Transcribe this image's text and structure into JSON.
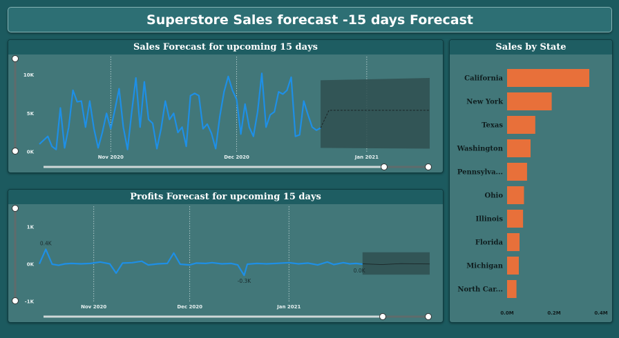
{
  "dashboard": {
    "title": "Superstore Sales forecast -15 days Forecast"
  },
  "panels": {
    "sales": {
      "title": "Sales Forecast for upcoming 15 days"
    },
    "profit": {
      "title": "Profits Forecast for upcoming 15 days"
    },
    "state": {
      "title": "Sales by State"
    }
  },
  "colors": {
    "background": "#1c5a5f",
    "panel": "#427779",
    "line": "#1e8fe6",
    "bar": "#e8703a",
    "forecast_band": "#2f4f50"
  },
  "chart_data": [
    {
      "type": "line",
      "title": "Sales Forecast for upcoming 15 days",
      "xlabel": "",
      "ylabel": "",
      "x_ticks": [
        "Nov 2020",
        "Dec 2020",
        "Jan 2021"
      ],
      "y_ticks": [
        "0K",
        "5K",
        "10K"
      ],
      "ylim": [
        0,
        10500
      ],
      "x_range": [
        "2020-10-15",
        "2021-01-16"
      ],
      "grid": false,
      "series": [
        {
          "values": [
            {
              "x": "2020-10-15",
              "y": 1000
            },
            {
              "x": "2020-10-16",
              "y": 1500
            },
            {
              "x": "2020-10-17",
              "y": 2000
            },
            {
              "x": "2020-10-18",
              "y": 700
            },
            {
              "x": "2020-10-19",
              "y": 300
            },
            {
              "x": "2020-10-20",
              "y": 5700
            },
            {
              "x": "2020-10-21",
              "y": 500
            },
            {
              "x": "2020-10-22",
              "y": 3200
            },
            {
              "x": "2020-10-23",
              "y": 8000
            },
            {
              "x": "2020-10-24",
              "y": 6500
            },
            {
              "x": "2020-10-25",
              "y": 6600
            },
            {
              "x": "2020-10-26",
              "y": 3200
            },
            {
              "x": "2020-10-27",
              "y": 6600
            },
            {
              "x": "2020-10-28",
              "y": 3000
            },
            {
              "x": "2020-10-29",
              "y": 500
            },
            {
              "x": "2020-10-30",
              "y": 2500
            },
            {
              "x": "2020-10-31",
              "y": 5000
            },
            {
              "x": "2020-11-01",
              "y": 3000
            },
            {
              "x": "2020-11-02",
              "y": 5500
            },
            {
              "x": "2020-11-03",
              "y": 8200
            },
            {
              "x": "2020-11-04",
              "y": 3200
            },
            {
              "x": "2020-11-05",
              "y": 300
            },
            {
              "x": "2020-11-06",
              "y": 5200
            },
            {
              "x": "2020-11-07",
              "y": 9600
            },
            {
              "x": "2020-11-08",
              "y": 3200
            },
            {
              "x": "2020-11-09",
              "y": 9100
            },
            {
              "x": "2020-11-10",
              "y": 4200
            },
            {
              "x": "2020-11-11",
              "y": 3700
            },
            {
              "x": "2020-11-12",
              "y": 400
            },
            {
              "x": "2020-11-13",
              "y": 3000
            },
            {
              "x": "2020-11-14",
              "y": 6600
            },
            {
              "x": "2020-11-15",
              "y": 4200
            },
            {
              "x": "2020-11-16",
              "y": 5000
            },
            {
              "x": "2020-11-17",
              "y": 2500
            },
            {
              "x": "2020-11-18",
              "y": 3200
            },
            {
              "x": "2020-11-19",
              "y": 700
            },
            {
              "x": "2020-11-20",
              "y": 7300
            },
            {
              "x": "2020-11-21",
              "y": 7600
            },
            {
              "x": "2020-11-22",
              "y": 7300
            },
            {
              "x": "2020-11-23",
              "y": 3000
            },
            {
              "x": "2020-11-24",
              "y": 3600
            },
            {
              "x": "2020-11-25",
              "y": 2400
            },
            {
              "x": "2020-11-26",
              "y": 400
            },
            {
              "x": "2020-11-27",
              "y": 4600
            },
            {
              "x": "2020-11-28",
              "y": 7800
            },
            {
              "x": "2020-11-29",
              "y": 9800
            },
            {
              "x": "2020-11-30",
              "y": 8000
            },
            {
              "x": "2020-12-01",
              "y": 6800
            },
            {
              "x": "2020-12-02",
              "y": 2300
            },
            {
              "x": "2020-12-03",
              "y": 6200
            },
            {
              "x": "2020-12-04",
              "y": 3200
            },
            {
              "x": "2020-12-05",
              "y": 2000
            },
            {
              "x": "2020-12-06",
              "y": 5200
            },
            {
              "x": "2020-12-07",
              "y": 10200
            },
            {
              "x": "2020-12-08",
              "y": 3200
            },
            {
              "x": "2020-12-09",
              "y": 4800
            },
            {
              "x": "2020-12-10",
              "y": 5200
            },
            {
              "x": "2020-12-11",
              "y": 7800
            },
            {
              "x": "2020-12-12",
              "y": 7500
            },
            {
              "x": "2020-12-13",
              "y": 8000
            },
            {
              "x": "2020-12-14",
              "y": 9700
            },
            {
              "x": "2020-12-15",
              "y": 2000
            },
            {
              "x": "2020-12-16",
              "y": 2200
            },
            {
              "x": "2020-12-17",
              "y": 6600
            },
            {
              "x": "2020-12-18",
              "y": 4800
            },
            {
              "x": "2020-12-19",
              "y": 3200
            },
            {
              "x": "2020-12-20",
              "y": 2800
            },
            {
              "x": "2020-12-21",
              "y": 3100
            }
          ]
        }
      ],
      "forecast": {
        "x": [
          "2020-12-21",
          "2021-01-16"
        ],
        "point": 5400,
        "lower_start": 500,
        "lower_end": 400,
        "upper_start": 9300,
        "upper_end": 9600
      }
    },
    {
      "type": "line",
      "title": "Profits Forecast for upcoming 15 days",
      "xlabel": "",
      "ylabel": "",
      "x_ticks": [
        "Nov 2020",
        "Dec 2020",
        "Jan 2021"
      ],
      "y_ticks": [
        "-1K",
        "0K",
        "1K"
      ],
      "ylim": [
        -1000,
        1000
      ],
      "x_range": [
        "2020-10-15",
        "2021-01-16"
      ],
      "grid": false,
      "data_labels": [
        "0.4K",
        "-0.3K",
        "0.0K"
      ],
      "series": [
        {
          "values": [
            {
              "x": "2020-10-15",
              "y": 10
            },
            {
              "x": "2020-10-17",
              "y": 400
            },
            {
              "x": "2020-10-19",
              "y": 0
            },
            {
              "x": "2020-10-21",
              "y": -30
            },
            {
              "x": "2020-10-23",
              "y": 10
            },
            {
              "x": "2020-10-25",
              "y": 20
            },
            {
              "x": "2020-10-28",
              "y": 10
            },
            {
              "x": "2020-10-31",
              "y": 20
            },
            {
              "x": "2020-11-03",
              "y": 60
            },
            {
              "x": "2020-11-06",
              "y": 10
            },
            {
              "x": "2020-11-08",
              "y": -240
            },
            {
              "x": "2020-11-10",
              "y": 30
            },
            {
              "x": "2020-11-13",
              "y": 40
            },
            {
              "x": "2020-11-16",
              "y": 80
            },
            {
              "x": "2020-11-18",
              "y": -20
            },
            {
              "x": "2020-11-21",
              "y": 10
            },
            {
              "x": "2020-11-24",
              "y": 20
            },
            {
              "x": "2020-11-26",
              "y": 300
            },
            {
              "x": "2020-11-28",
              "y": 0
            },
            {
              "x": "2020-12-01",
              "y": -20
            },
            {
              "x": "2020-12-03",
              "y": 30
            },
            {
              "x": "2020-12-06",
              "y": 20
            },
            {
              "x": "2020-12-08",
              "y": 40
            },
            {
              "x": "2020-12-11",
              "y": 10
            },
            {
              "x": "2020-12-14",
              "y": 20
            },
            {
              "x": "2020-12-16",
              "y": -20
            },
            {
              "x": "2020-12-18",
              "y": -300
            },
            {
              "x": "2020-12-19",
              "y": 0
            },
            {
              "x": "2020-12-22",
              "y": 20
            },
            {
              "x": "2020-12-25",
              "y": 10
            },
            {
              "x": "2020-12-28",
              "y": 20
            },
            {
              "x": "2021-01-01",
              "y": 40
            },
            {
              "x": "2021-01-04",
              "y": 10
            },
            {
              "x": "2021-01-07",
              "y": 30
            },
            {
              "x": "2021-01-10",
              "y": -20
            },
            {
              "x": "2021-01-13",
              "y": 60
            },
            {
              "x": "2021-01-15",
              "y": -10
            },
            {
              "x": "2021-01-18",
              "y": 40
            },
            {
              "x": "2021-01-20",
              "y": 10
            },
            {
              "x": "2021-01-22",
              "y": 20
            },
            {
              "x": "2021-01-24",
              "y": 0
            }
          ]
        }
      ],
      "forecast": {
        "x": [
          "2021-01-24",
          "2021-02-14"
        ],
        "point": 0,
        "lower": -280,
        "upper": 320
      }
    },
    {
      "type": "bar",
      "orientation": "horizontal",
      "title": "Sales by State",
      "categories": [
        "California",
        "New York",
        "Texas",
        "Washington",
        "Pennsylva...",
        "Ohio",
        "Illinois",
        "Florida",
        "Michigan",
        "North Car..."
      ],
      "values": [
        0.35,
        0.19,
        0.12,
        0.1,
        0.085,
        0.072,
        0.068,
        0.053,
        0.05,
        0.04
      ],
      "x_ticks": [
        "0.0M",
        "0.2M",
        "0.4M"
      ],
      "xlim": [
        0,
        0.4
      ]
    }
  ]
}
